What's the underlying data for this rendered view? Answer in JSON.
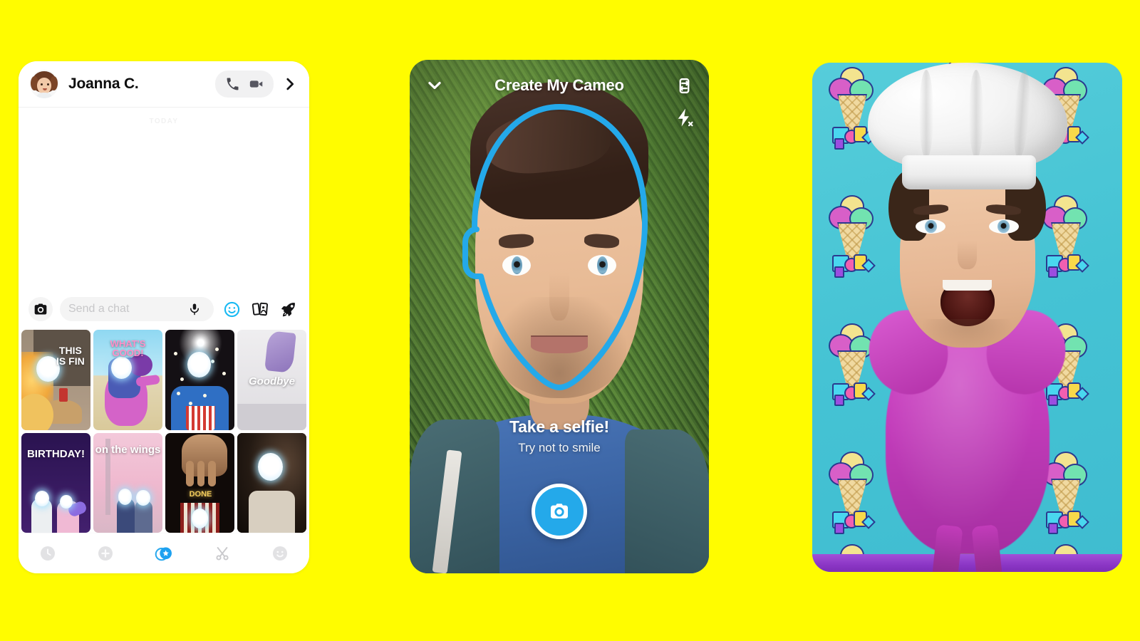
{
  "background_color": "#FFFC00",
  "accent_blue": "#24A9EA",
  "chat_panel": {
    "name": "chat-screen",
    "header": {
      "avatar": "bitmoji-avatar",
      "contact_name": "Joanna C.",
      "voice_call_icon": "phone-icon",
      "video_call_icon": "video-camera-icon",
      "forward_icon": "chevron-right-icon"
    },
    "conversation": {
      "day_divider": "TODAY",
      "messages": []
    },
    "input_bar": {
      "camera_icon": "camera-icon",
      "placeholder": "Send a chat",
      "mic_icon": "microphone-icon",
      "sticker_icon": "smiley-sticker-icon",
      "cameo_icon": "cameo-cards-icon",
      "rocket_icon": "rocket-icon"
    },
    "cameo_grid": [
      {
        "id": "cameo-1",
        "label": "THIS IS FIN"
      },
      {
        "id": "cameo-2",
        "label": "WHAT'S GOOD!"
      },
      {
        "id": "cameo-3",
        "label": ""
      },
      {
        "id": "cameo-4",
        "label": "Goodbye"
      },
      {
        "id": "cameo-5",
        "label": "BIRTHDAY!"
      },
      {
        "id": "cameo-6",
        "label": "on the wings"
      },
      {
        "id": "cameo-7",
        "label": "DONE"
      },
      {
        "id": "cameo-8",
        "label": ""
      }
    ],
    "tab_bar": [
      {
        "id": "tab-recent",
        "icon": "clock-icon",
        "active": false
      },
      {
        "id": "tab-stickers",
        "icon": "plus-sticker-icon",
        "active": false
      },
      {
        "id": "tab-cameos",
        "icon": "cameo-sparkle-icon",
        "active": true
      },
      {
        "id": "tab-cutouts",
        "icon": "scissors-icon",
        "active": false
      },
      {
        "id": "tab-emoji",
        "icon": "smiley-icon",
        "active": false
      }
    ]
  },
  "camera_panel": {
    "name": "create-my-cameo-screen",
    "title": "Create My Cameo",
    "collapse_icon": "chevron-down-icon",
    "flip_camera_icon": "flip-camera-icon",
    "flash_icon": "flash-off-icon",
    "face_guide": "face-outline-guide",
    "caption_main": "Take a selfie!",
    "caption_sub": "Try not to smile",
    "shutter_icon": "shutter-camera-icon"
  },
  "result_panel": {
    "name": "cameo-result-screen",
    "background_pattern": "ice-cream-cone-pattern",
    "background_color": "#48C6D6",
    "hat": "chef-hat",
    "character": "purple-bird-body",
    "perch": "purple-perch-bar"
  }
}
